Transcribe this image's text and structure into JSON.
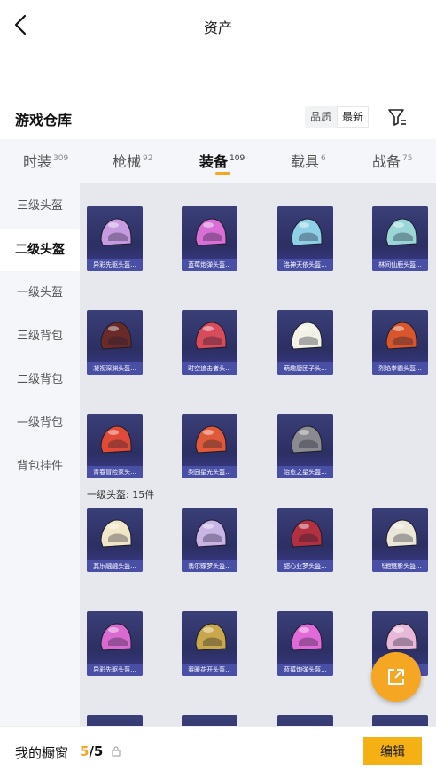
{
  "header": {
    "title": "资产",
    "back_icon": "chevron-left-icon"
  },
  "warehouse": {
    "title": "游戏仓库",
    "sort_options": [
      "品质",
      "最新"
    ],
    "sort_selected": "最新",
    "filter_icon": "filter-icon"
  },
  "tabs": [
    {
      "label": "时装",
      "count": "309"
    },
    {
      "label": "枪械",
      "count": "92"
    },
    {
      "label": "装备",
      "count": "109",
      "active": true
    },
    {
      "label": "载具",
      "count": "6"
    },
    {
      "label": "战备",
      "count": "75"
    }
  ],
  "sidebar": [
    {
      "label": "三级头盔"
    },
    {
      "label": "二级头盔",
      "active": true
    },
    {
      "label": "一级头盔"
    },
    {
      "label": "三级背包"
    },
    {
      "label": "二级背包"
    },
    {
      "label": "一级背包"
    },
    {
      "label": "背包挂件"
    }
  ],
  "items_level2": [
    {
      "name": "异彩先驱头盔...",
      "color": "#c79be0"
    },
    {
      "name": "蓝莓炮弹头盔...",
      "color": "#d96fd6"
    },
    {
      "name": "洛神天依头盔...",
      "color": "#8fd0e6"
    },
    {
      "name": "林间仙鹿头盔...",
      "color": "#9ad6d8"
    },
    {
      "name": "凝视深渊头盔...",
      "color": "#6b2a2a"
    },
    {
      "name": "时空追击者头...",
      "color": "#d84b5a"
    },
    {
      "name": "萌趣厨团子头...",
      "color": "#f2f2e6"
    },
    {
      "name": "烈焰拳霸头盔...",
      "color": "#d8562e"
    },
    {
      "name": "青春冒险家头...",
      "color": "#e04a36"
    },
    {
      "name": "梨园星光头盔...",
      "color": "#e05a3a"
    },
    {
      "name": "治愈之星头盔...",
      "color": "#8a8a90"
    }
  ],
  "section_level1": {
    "label": "一级头盔: 15件"
  },
  "items_level1": [
    {
      "name": "其乐融融头盔...",
      "color": "#f2e6c8"
    },
    {
      "name": "翡尔蝶梦头盔...",
      "color": "#c9b4e6"
    },
    {
      "name": "甜心亚梦头盔...",
      "color": "#b23040"
    },
    {
      "name": "飞驰魅影头盔...",
      "color": "#ece6d8"
    },
    {
      "name": "异彩先驱头盔...",
      "color": "#d86ad0"
    },
    {
      "name": "春暖花开头盔...",
      "color": "#c8a84a"
    },
    {
      "name": "蓝莓炮弹头盔...",
      "color": "#e06ad8"
    },
    {
      "name": "",
      "color": "#e8b8d8"
    }
  ],
  "bottom": {
    "label": "我的橱窗",
    "current": "5",
    "total": "/5",
    "lock_icon": "lock-icon",
    "edit_label": "编辑"
  },
  "fab": {
    "icon": "share-external-icon"
  },
  "accent_color": "#f5a623"
}
